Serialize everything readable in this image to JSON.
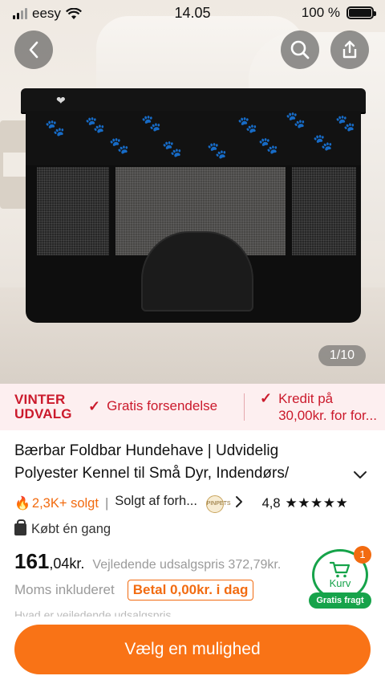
{
  "status_bar": {
    "carrier": "eesy",
    "time": "14.05",
    "battery": "100 %",
    "battery_level": 1.0
  },
  "gallery": {
    "counter": "1/10"
  },
  "promo": {
    "badge_line1": "VINTER",
    "badge_line2": "UDVALG",
    "free_shipping": "Gratis forsendelse",
    "credit_line1": "Kredit på",
    "credit_line2": "30,00kr. for for..."
  },
  "product": {
    "title": "Bærbar Foldbar Hundehave | Udvidelig Polyester Kennel til Små Dyr, Indendørs/",
    "sold": "2,3K+ solgt",
    "seller": "Solgt af forh...",
    "seller_logo_text": "PINPETS",
    "rating": "4,8",
    "stars": "★★★★★",
    "bought_once": "Købt én gang",
    "price_int": "161",
    "price_dec": ",04kr.",
    "reference_price": "Vejledende udsalgspris 372,79kr.",
    "tax_note": "Moms inkluderet",
    "pay_badge": "Betal 0,00kr. i dag",
    "partial_line": "Hvad er vejledende udsalgspris"
  },
  "cart": {
    "count": "1",
    "label": "Kurv",
    "free_shipping": "Gratis fragt"
  },
  "cta": {
    "label": "Vælg en mulighed"
  },
  "colors": {
    "accent_orange": "#f97316",
    "promo_red": "#cb1a2c",
    "cart_green": "#16a34a"
  },
  "icons": [
    "back-icon",
    "search-icon",
    "share-icon",
    "wifi-icon",
    "signal-icon",
    "battery-icon",
    "check-icon",
    "flame-icon",
    "chevron-right-icon",
    "chevron-down-icon",
    "bag-icon",
    "cart-icon"
  ]
}
